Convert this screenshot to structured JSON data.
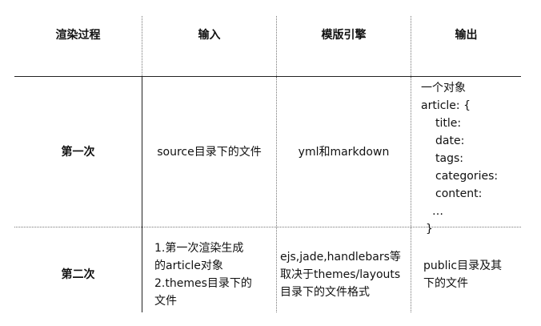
{
  "table": {
    "headers": [
      "渲染过程",
      "输入",
      "模版引擎",
      "输出"
    ],
    "rows": [
      {
        "stage": "第一次",
        "input": "source目录下的文件",
        "engine": "yml和markdown",
        "output_lines": [
          "一个对象",
          "article: {",
          "title:",
          "date:",
          "tags:",
          "categories:",
          "content:",
          "…",
          "}"
        ]
      },
      {
        "stage": "第二次",
        "input_lines": [
          "1.第一次渲染生成",
          "的article对象",
          "2.themes目录下的",
          "文件"
        ],
        "engine_lines": [
          "ejs,jade,handlebars等",
          "取决于themes/layouts",
          "目录下的文件格式"
        ],
        "output_lines": [
          "public目录及其",
          "下的文件"
        ]
      }
    ]
  }
}
